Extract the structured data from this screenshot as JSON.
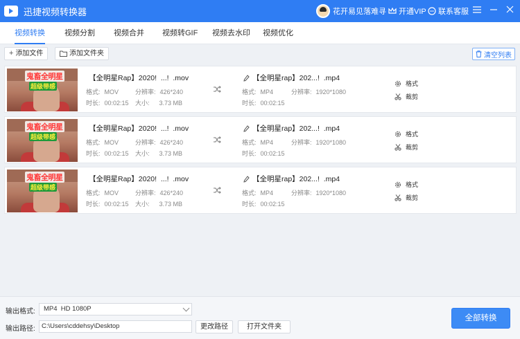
{
  "app": {
    "title": "迅捷视频转换器"
  },
  "header": {
    "username": "花开易见落难寻",
    "vip_label": "开通VIP",
    "support_label": "联系客服"
  },
  "tabs": [
    {
      "label": "视频转换",
      "active": true
    },
    {
      "label": "视频分割",
      "active": false
    },
    {
      "label": "视频合并",
      "active": false
    },
    {
      "label": "视频转GIF",
      "active": false
    },
    {
      "label": "视频去水印",
      "active": false
    },
    {
      "label": "视频优化",
      "active": false
    }
  ],
  "toolbar": {
    "add_file": "添加文件",
    "add_folder": "添加文件夹",
    "clear_list": "清空列表"
  },
  "labels": {
    "format": "格式:",
    "resolution": "分辨率:",
    "duration": "时长:",
    "size": "大小:",
    "format_op": "格式",
    "cut_op": "裁剪"
  },
  "files": [
    {
      "thumb_line1": "鬼畜全明星",
      "thumb_line2": "超级带感",
      "src_name": "【全明星Rap】2020!  ...!  .mov",
      "src_format": "MOV",
      "src_resolution": "426*240",
      "src_duration": "00:02:15",
      "src_size": "3.73 MB",
      "dst_name": "【全明星rap】202...!  .mp4",
      "dst_format": "MP4",
      "dst_resolution": "1920*1080",
      "dst_duration": "00:02:15"
    },
    {
      "thumb_line1": "鬼畜全明星",
      "thumb_line2": "超级带感",
      "src_name": "【全明星Rap】2020!  ...!  .mov",
      "src_format": "MOV",
      "src_resolution": "426*240",
      "src_duration": "00:02:15",
      "src_size": "3.73 MB",
      "dst_name": "【全明星rap】202...!  .mp4",
      "dst_format": "MP4",
      "dst_resolution": "1920*1080",
      "dst_duration": "00:02:15"
    },
    {
      "thumb_line1": "鬼畜全明星",
      "thumb_line2": "超级带感",
      "src_name": "【全明星Rap】2020!  ...!  .mov",
      "src_format": "MOV",
      "src_resolution": "426*240",
      "src_duration": "00:02:15",
      "src_size": "3.73 MB",
      "dst_name": "【全明星rap】202...!  .mp4",
      "dst_format": "MP4",
      "dst_resolution": "1920*1080",
      "dst_duration": "00:02:15"
    }
  ],
  "output": {
    "format_label": "输出格式:",
    "format_value": "MP4  HD 1080P",
    "path_label": "输出路径:",
    "path_value": "C:\\Users\\cddehsy\\Desktop",
    "change_path": "更改路径",
    "open_folder": "打开文件夹",
    "convert_all": "全部转换"
  },
  "colors": {
    "accent": "#2f7df3",
    "titlebar": "#2f7df3"
  }
}
